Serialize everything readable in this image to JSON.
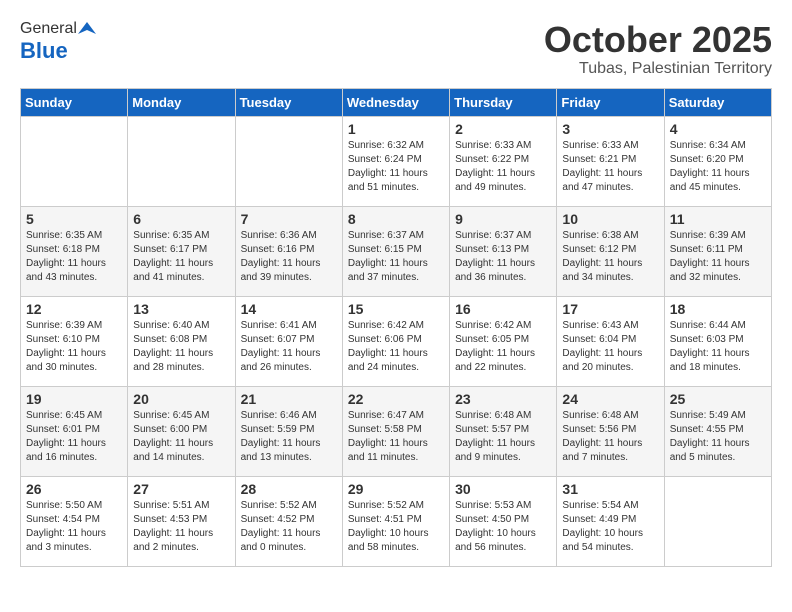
{
  "header": {
    "logo_general": "General",
    "logo_blue": "Blue",
    "month_title": "October 2025",
    "location": "Tubas, Palestinian Territory"
  },
  "days_of_week": [
    "Sunday",
    "Monday",
    "Tuesday",
    "Wednesday",
    "Thursday",
    "Friday",
    "Saturday"
  ],
  "weeks": [
    [
      {
        "day": "",
        "text": ""
      },
      {
        "day": "",
        "text": ""
      },
      {
        "day": "",
        "text": ""
      },
      {
        "day": "1",
        "text": "Sunrise: 6:32 AM\nSunset: 6:24 PM\nDaylight: 11 hours\nand 51 minutes."
      },
      {
        "day": "2",
        "text": "Sunrise: 6:33 AM\nSunset: 6:22 PM\nDaylight: 11 hours\nand 49 minutes."
      },
      {
        "day": "3",
        "text": "Sunrise: 6:33 AM\nSunset: 6:21 PM\nDaylight: 11 hours\nand 47 minutes."
      },
      {
        "day": "4",
        "text": "Sunrise: 6:34 AM\nSunset: 6:20 PM\nDaylight: 11 hours\nand 45 minutes."
      }
    ],
    [
      {
        "day": "5",
        "text": "Sunrise: 6:35 AM\nSunset: 6:18 PM\nDaylight: 11 hours\nand 43 minutes."
      },
      {
        "day": "6",
        "text": "Sunrise: 6:35 AM\nSunset: 6:17 PM\nDaylight: 11 hours\nand 41 minutes."
      },
      {
        "day": "7",
        "text": "Sunrise: 6:36 AM\nSunset: 6:16 PM\nDaylight: 11 hours\nand 39 minutes."
      },
      {
        "day": "8",
        "text": "Sunrise: 6:37 AM\nSunset: 6:15 PM\nDaylight: 11 hours\nand 37 minutes."
      },
      {
        "day": "9",
        "text": "Sunrise: 6:37 AM\nSunset: 6:13 PM\nDaylight: 11 hours\nand 36 minutes."
      },
      {
        "day": "10",
        "text": "Sunrise: 6:38 AM\nSunset: 6:12 PM\nDaylight: 11 hours\nand 34 minutes."
      },
      {
        "day": "11",
        "text": "Sunrise: 6:39 AM\nSunset: 6:11 PM\nDaylight: 11 hours\nand 32 minutes."
      }
    ],
    [
      {
        "day": "12",
        "text": "Sunrise: 6:39 AM\nSunset: 6:10 PM\nDaylight: 11 hours\nand 30 minutes."
      },
      {
        "day": "13",
        "text": "Sunrise: 6:40 AM\nSunset: 6:08 PM\nDaylight: 11 hours\nand 28 minutes."
      },
      {
        "day": "14",
        "text": "Sunrise: 6:41 AM\nSunset: 6:07 PM\nDaylight: 11 hours\nand 26 minutes."
      },
      {
        "day": "15",
        "text": "Sunrise: 6:42 AM\nSunset: 6:06 PM\nDaylight: 11 hours\nand 24 minutes."
      },
      {
        "day": "16",
        "text": "Sunrise: 6:42 AM\nSunset: 6:05 PM\nDaylight: 11 hours\nand 22 minutes."
      },
      {
        "day": "17",
        "text": "Sunrise: 6:43 AM\nSunset: 6:04 PM\nDaylight: 11 hours\nand 20 minutes."
      },
      {
        "day": "18",
        "text": "Sunrise: 6:44 AM\nSunset: 6:03 PM\nDaylight: 11 hours\nand 18 minutes."
      }
    ],
    [
      {
        "day": "19",
        "text": "Sunrise: 6:45 AM\nSunset: 6:01 PM\nDaylight: 11 hours\nand 16 minutes."
      },
      {
        "day": "20",
        "text": "Sunrise: 6:45 AM\nSunset: 6:00 PM\nDaylight: 11 hours\nand 14 minutes."
      },
      {
        "day": "21",
        "text": "Sunrise: 6:46 AM\nSunset: 5:59 PM\nDaylight: 11 hours\nand 13 minutes."
      },
      {
        "day": "22",
        "text": "Sunrise: 6:47 AM\nSunset: 5:58 PM\nDaylight: 11 hours\nand 11 minutes."
      },
      {
        "day": "23",
        "text": "Sunrise: 6:48 AM\nSunset: 5:57 PM\nDaylight: 11 hours\nand 9 minutes."
      },
      {
        "day": "24",
        "text": "Sunrise: 6:48 AM\nSunset: 5:56 PM\nDaylight: 11 hours\nand 7 minutes."
      },
      {
        "day": "25",
        "text": "Sunrise: 5:49 AM\nSunset: 4:55 PM\nDaylight: 11 hours\nand 5 minutes."
      }
    ],
    [
      {
        "day": "26",
        "text": "Sunrise: 5:50 AM\nSunset: 4:54 PM\nDaylight: 11 hours\nand 3 minutes."
      },
      {
        "day": "27",
        "text": "Sunrise: 5:51 AM\nSunset: 4:53 PM\nDaylight: 11 hours\nand 2 minutes."
      },
      {
        "day": "28",
        "text": "Sunrise: 5:52 AM\nSunset: 4:52 PM\nDaylight: 11 hours\nand 0 minutes."
      },
      {
        "day": "29",
        "text": "Sunrise: 5:52 AM\nSunset: 4:51 PM\nDaylight: 10 hours\nand 58 minutes."
      },
      {
        "day": "30",
        "text": "Sunrise: 5:53 AM\nSunset: 4:50 PM\nDaylight: 10 hours\nand 56 minutes."
      },
      {
        "day": "31",
        "text": "Sunrise: 5:54 AM\nSunset: 4:49 PM\nDaylight: 10 hours\nand 54 minutes."
      },
      {
        "day": "",
        "text": ""
      }
    ]
  ]
}
